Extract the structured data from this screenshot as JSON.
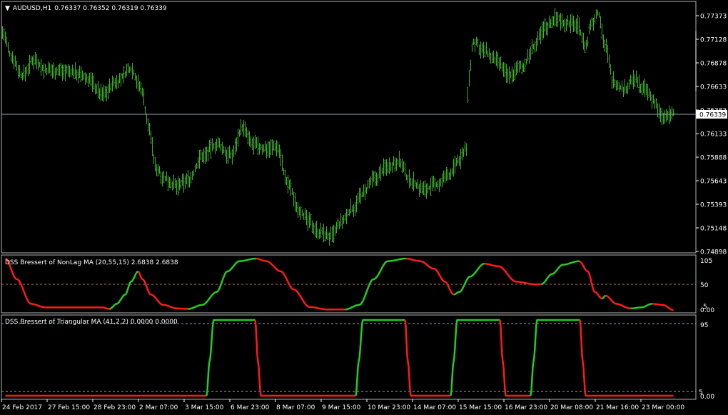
{
  "chart_title": {
    "arrow": "▼",
    "symbol": "AUDUSD,H1",
    "ohlc": "0.76337 0.76352 0.76319 0.76339"
  },
  "colors": {
    "background": "#000000",
    "bars": "#3fae2a",
    "current_price_line": "#8aa8b8",
    "indicator_up": "#22cc22",
    "indicator_down": "#ff1a1a",
    "dss1_level": "#c8781e",
    "dss2_level": "#9aa8b0",
    "panel_border": "#b4b4b4",
    "current_price_box": "#ffffff"
  },
  "price_scale": {
    "levels": [
      "0.77373",
      "0.77128",
      "0.76878",
      "0.76633",
      "0.76383",
      "0.76133",
      "0.75888",
      "0.75643",
      "0.75393",
      "0.75148",
      "0.74898"
    ],
    "current": "0.76339"
  },
  "dss1": {
    "title": "DSS Bressert of NonLag MA (20,55,15) 2.6838 2.6838",
    "levels": [
      "105",
      "50",
      "0.00",
      "5"
    ]
  },
  "dss2": {
    "title": "DSS Bressert of Triangular MA (41,2,2) 0.0000 0.0000",
    "levels": [
      "95",
      "5",
      "0.00"
    ]
  },
  "time_axis": [
    "24 Feb 2017",
    "27 Feb 15:00",
    "28 Feb 23:00",
    "2 Mar 07:00",
    "3 Mar 15:00",
    "6 Mar 23:00",
    "8 Mar 07:00",
    "9 Mar 15:00",
    "10 Mar 23:00",
    "14 Mar 07:00",
    "15 Mar 15:00",
    "16 Mar 23:00",
    "20 Mar 08:00",
    "21 Mar 16:00",
    "23 Mar 00:00"
  ],
  "chart_data": [
    {
      "type": "bar",
      "series": [
        {
          "name": "AUDUSD,H1",
          "anchors": [
            [
              0,
              0.772
            ],
            [
              12,
              0.7695
            ],
            [
              28,
              0.7675
            ],
            [
              45,
              0.7692
            ],
            [
              60,
              0.768
            ],
            [
              80,
              0.768
            ],
            [
              100,
              0.7678
            ],
            [
              120,
              0.7671
            ],
            [
              140,
              0.7655
            ],
            [
              160,
              0.7668
            ],
            [
              180,
              0.7682
            ],
            [
              195,
              0.766
            ],
            [
              205,
              0.762
            ],
            [
              215,
              0.7578
            ],
            [
              228,
              0.7566
            ],
            [
              245,
              0.7558
            ],
            [
              262,
              0.7566
            ],
            [
              280,
              0.759
            ],
            [
              300,
              0.7602
            ],
            [
              320,
              0.759
            ],
            [
              336,
              0.762
            ],
            [
              350,
              0.7602
            ],
            [
              365,
              0.7598
            ],
            [
              385,
              0.76
            ],
            [
              400,
              0.756
            ],
            [
              415,
              0.7535
            ],
            [
              430,
              0.752
            ],
            [
              445,
              0.751
            ],
            [
              460,
              0.7505
            ],
            [
              475,
              0.752
            ],
            [
              490,
              0.7535
            ],
            [
              505,
              0.755
            ],
            [
              520,
              0.7565
            ],
            [
              540,
              0.758
            ],
            [
              555,
              0.7585
            ],
            [
              570,
              0.7565
            ],
            [
              590,
              0.7555
            ],
            [
              610,
              0.756
            ],
            [
              625,
              0.757
            ],
            [
              640,
              0.7585
            ],
            [
              650,
              0.76
            ],
            [
              653,
              0.767
            ],
            [
              660,
              0.771
            ],
            [
              675,
              0.77
            ],
            [
              690,
              0.769
            ],
            [
              710,
              0.7675
            ],
            [
              730,
              0.7685
            ],
            [
              745,
              0.7705
            ],
            [
              760,
              0.7725
            ],
            [
              775,
              0.7735
            ],
            [
              790,
              0.773
            ],
            [
              805,
              0.7728
            ],
            [
              818,
              0.7705
            ],
            [
              825,
              0.773
            ],
            [
              835,
              0.774
            ],
            [
              845,
              0.7705
            ],
            [
              855,
              0.767
            ],
            [
              870,
              0.766
            ],
            [
              885,
              0.767
            ],
            [
              900,
              0.766
            ],
            [
              912,
              0.7648
            ],
            [
              925,
              0.763
            ],
            [
              940,
              0.7634
            ]
          ]
        }
      ]
    },
    {
      "type": "line",
      "series": [
        {
          "name": "DSS Bressert of NonLag MA (20,55,15)",
          "anchors": [
            [
              4,
              100
            ],
            [
              20,
              60
            ],
            [
              40,
              12
            ],
            [
              60,
              5
            ],
            [
              90,
              5
            ],
            [
              120,
              5
            ],
            [
              140,
              5
            ],
            [
              150,
              2
            ],
            [
              160,
              12
            ],
            [
              172,
              30
            ],
            [
              180,
              55
            ],
            [
              190,
              75
            ],
            [
              196,
              60
            ],
            [
              208,
              30
            ],
            [
              225,
              10
            ],
            [
              245,
              3
            ],
            [
              260,
              2
            ],
            [
              280,
              10
            ],
            [
              300,
              35
            ],
            [
              315,
              75
            ],
            [
              332,
              95
            ],
            [
              355,
              100
            ],
            [
              370,
              95
            ],
            [
              390,
              75
            ],
            [
              408,
              40
            ],
            [
              430,
              6
            ],
            [
              455,
              1
            ],
            [
              480,
              1
            ],
            [
              500,
              10
            ],
            [
              520,
              60
            ],
            [
              540,
              95
            ],
            [
              565,
              100
            ],
            [
              585,
              95
            ],
            [
              605,
              80
            ],
            [
              620,
              55
            ],
            [
              632,
              30
            ],
            [
              640,
              35
            ],
            [
              655,
              65
            ],
            [
              675,
              90
            ],
            [
              695,
              85
            ],
            [
              720,
              55
            ],
            [
              745,
              50
            ],
            [
              755,
              50
            ],
            [
              770,
              70
            ],
            [
              785,
              88
            ],
            [
              808,
              95
            ],
            [
              820,
              75
            ],
            [
              830,
              35
            ],
            [
              840,
              22
            ],
            [
              845,
              28
            ],
            [
              860,
              12
            ],
            [
              880,
              3
            ],
            [
              895,
              5
            ],
            [
              910,
              12
            ],
            [
              925,
              10
            ],
            [
              940,
              0
            ]
          ]
        }
      ]
    },
    {
      "type": "line",
      "series": [
        {
          "name": "DSS Bressert of Triangular MA (41,2,2)",
          "anchors": [
            [
              4,
              0
            ],
            [
              286,
              0
            ],
            [
              290,
              45
            ],
            [
              296,
              100
            ],
            [
              354,
              100
            ],
            [
              358,
              45
            ],
            [
              362,
              0
            ],
            [
              495,
              0
            ],
            [
              499,
              45
            ],
            [
              505,
              100
            ],
            [
              564,
              100
            ],
            [
              568,
              45
            ],
            [
              572,
              0
            ],
            [
              628,
              0
            ],
            [
              632,
              45
            ],
            [
              637,
              100
            ],
            [
              697,
              100
            ],
            [
              701,
              45
            ],
            [
              705,
              0
            ],
            [
              740,
              0
            ],
            [
              744,
              45
            ],
            [
              749,
              100
            ],
            [
              809,
              100
            ],
            [
              813,
              45
            ],
            [
              817,
              0
            ],
            [
              940,
              0
            ]
          ]
        }
      ]
    }
  ]
}
